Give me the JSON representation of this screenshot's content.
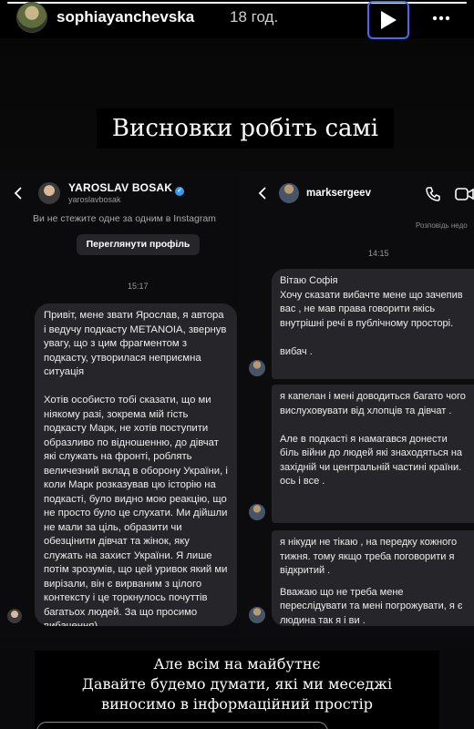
{
  "story": {
    "username": "sophiayanchevska",
    "time_ago": "18 год.",
    "progress": 1.0,
    "top_caption": "Висновки робіть самі",
    "bottom_caption": [
      "Але всім на майбутнє",
      "Давайте будемо думати, які ми меседжі",
      "виносимо в інформаційний простір"
    ]
  },
  "left_chat": {
    "name": "YAROSLAV BOSAK",
    "handle": "yaroslavbosak",
    "not_following": "Ви не стежите одне за одним в Instagram",
    "view_profile": "Переглянути профіль",
    "time": "15:17",
    "message": [
      "Привіт, мене звати Ярослав, я автора і ведучу подкасту METANOIA, звернув увагу, що з цим фрагментом з подкасту, утворилася неприємна ситуація",
      "Хотів особисто тобі сказати, що ми ніякому разі, зокрема мій гість подкасту Марк, не хотів поступити образливо по відношенню, до дівчат які служать на фронті, роблять величезний вклад в оборону України, і коли Марк розказував цю історію на подкасті, було видно мою реакцію, що не просто було це слухати. Ми дійшли не мали за ціль, образити чи обезцінити дівчат та жінок, яку служать на захист України. Я лише потім зрозумів, що цей уривок який ми вирізали, він є вирваним з цілого контексту і це торкнулось почуттів багатьох людей. За що просимо вибачення)"
    ]
  },
  "right_chat": {
    "name": "marksergeev",
    "seen": "Розповідь недо",
    "time": "14:15",
    "bubbles": [
      [
        "Вітаю Софія",
        "Хочу сказати вибачте мене що зачепив вас , не мав права говорити якісь внутрішні речі в публічному просторі.",
        "вибач ."
      ],
      [
        "я капелан і мені доводиться багато чого вислуховувати від хлопців та дівчат .",
        "Але в подкасті я намагався донести біль війни до людей які знаходяться на західній чи центральній частині країни.",
        "ось і все ."
      ],
      [
        "я нікуди не тікаю , на передку кожного тижня. тому якщо треба поговорити я відкритий .",
        "Вважаю що не треба мене переслідувати та мені погрожувати, я є людина так я і ви ."
      ]
    ]
  },
  "icons": [
    "back-arrow-icon",
    "play-icon",
    "more-icon",
    "verified-icon",
    "phone-icon",
    "video-icon"
  ]
}
